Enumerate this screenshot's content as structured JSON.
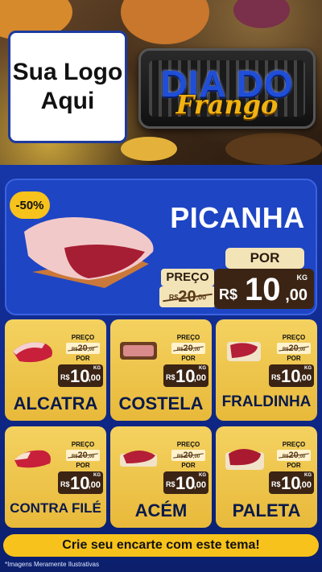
{
  "header": {
    "logo_text": "Sua Logo\nAqui",
    "title_line1": "DIA DO",
    "title_line2": "Frango"
  },
  "hero": {
    "discount": "-50%",
    "product": "PICANHA",
    "preco_label": "PREÇO",
    "por_label": "POR",
    "old_currency": "R$",
    "old_int": "20",
    "old_dec": ",00",
    "new_currency": "R$",
    "new_int": "10",
    "new_unit": "KG",
    "new_dec": ",00"
  },
  "cards": [
    {
      "name": "ALCATRA",
      "preco_label": "PREÇO",
      "por_label": "POR",
      "old_currency": "R$",
      "old_int": "20",
      "old_dec": ",00",
      "new_currency": "R$",
      "new_int": "10",
      "new_unit": "KG",
      "new_dec": ",00"
    },
    {
      "name": "COSTELA",
      "preco_label": "PREÇO",
      "por_label": "POR",
      "old_currency": "R$",
      "old_int": "20",
      "old_dec": ",00",
      "new_currency": "R$",
      "new_int": "10",
      "new_unit": "KG",
      "new_dec": ",00"
    },
    {
      "name": "FRALDINHA",
      "preco_label": "PREÇO",
      "por_label": "POR",
      "old_currency": "R$",
      "old_int": "20",
      "old_dec": ",00",
      "new_currency": "R$",
      "new_int": "10",
      "new_unit": "KG",
      "new_dec": ",00"
    },
    {
      "name": "CONTRA FILÉ",
      "preco_label": "PREÇO",
      "por_label": "POR",
      "old_currency": "R$",
      "old_int": "20",
      "old_dec": ",00",
      "new_currency": "R$",
      "new_int": "10",
      "new_unit": "KG",
      "new_dec": ",00"
    },
    {
      "name": "ACÉM",
      "preco_label": "PREÇO",
      "por_label": "POR",
      "old_currency": "R$",
      "old_int": "20",
      "old_dec": ",00",
      "new_currency": "R$",
      "new_int": "10",
      "new_unit": "KG",
      "new_dec": ",00"
    },
    {
      "name": "PALETA",
      "preco_label": "PREÇO",
      "por_label": "POR",
      "old_currency": "R$",
      "old_int": "20",
      "old_dec": ",00",
      "new_currency": "R$",
      "new_int": "10",
      "new_unit": "KG",
      "new_dec": ",00"
    }
  ],
  "footer": {
    "cta": "Crie seu encarte com este tema!",
    "disclaimer": "*Imagens Meramente Ilustrativas"
  },
  "colors": {
    "brand_blue": "#1e45c4",
    "accent_yellow": "#f7c21c",
    "price_brown": "#3b2414"
  }
}
